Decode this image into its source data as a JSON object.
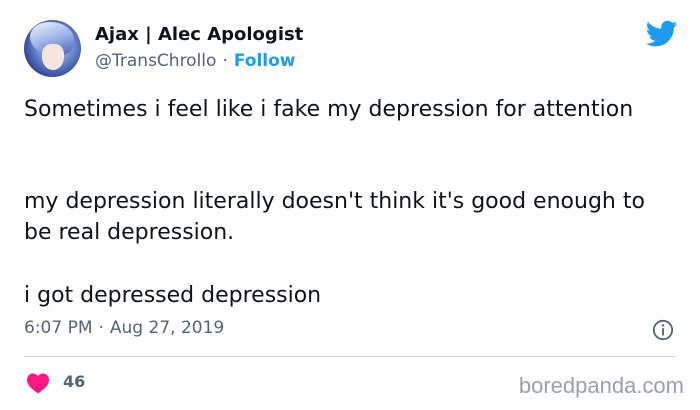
{
  "tweet": {
    "author_name": "Ajax | Alec Apologist",
    "handle": "@TransChrollo",
    "separator": "·",
    "follow_label": "Follow",
    "paragraphs": [
      "Sometimes i feel like i fake my depression for attention",
      "my depression literally doesn't think it's good enough to be real depression.",
      "i got depressed depression"
    ],
    "time": "6:07 PM",
    "date": "Aug 27, 2019",
    "like_count": "46"
  },
  "icons": {
    "brand": "twitter-bird-icon",
    "info": "info-icon",
    "like": "heart-icon"
  },
  "colors": {
    "accent": "#1d9bf0",
    "heart": "#f91880",
    "text": "#0f1419",
    "muted": "#536471"
  },
  "watermark": "boredpanda.com"
}
